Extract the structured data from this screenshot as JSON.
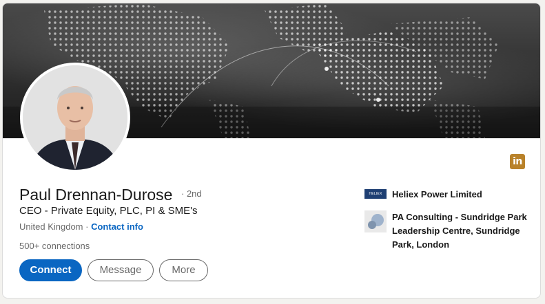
{
  "profile": {
    "name": "Paul Drennan-Durose",
    "degree": "· 2nd",
    "headline": "CEO - Private Equity, PLC, PI & SME's",
    "location": "United Kingdom",
    "separator": "·",
    "contact_info": "Contact info",
    "connections": "500+ connections"
  },
  "actions": {
    "connect": "Connect",
    "message": "Message",
    "more": "More"
  },
  "badge": {
    "label": "in",
    "icon": "linkedin-icon",
    "color": "#b9822a"
  },
  "organizations": [
    {
      "name": "Heliex Power Limited",
      "logo_text": "HELIEX",
      "logo_icon": "heliex-logo"
    },
    {
      "name": "PA Consulting - Sundridge Park Leadership Centre, Sundridge Park, London",
      "logo_icon": "pa-consulting-logo"
    }
  ],
  "colors": {
    "accent": "#0a66c2",
    "banner": "#2c2c2c"
  }
}
